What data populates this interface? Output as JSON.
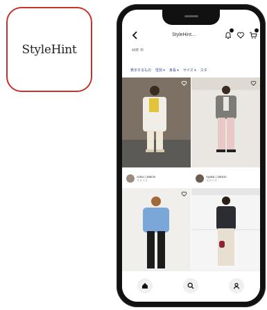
{
  "app_icon": {
    "label": "StyleHint",
    "border_color": "#c8312b"
  },
  "header": {
    "title": "StyleHint...",
    "back": "back-arrow-icon"
  },
  "subtitle": "43件 中",
  "filters": [
    {
      "label": "表示するもの"
    },
    {
      "label": "性別 ▾"
    },
    {
      "label": "身長 ▾"
    },
    {
      "label": "サイズ ▾"
    },
    {
      "label": "スタ"
    }
  ],
  "cards": [
    {
      "name": "Aoko | 165cm",
      "sub": "スタイル"
    },
    {
      "name": "Ayaka | 160cm",
      "sub": "スタイル"
    }
  ],
  "nav": {
    "home": "home-icon",
    "search": "search-icon",
    "account": "account-icon"
  }
}
